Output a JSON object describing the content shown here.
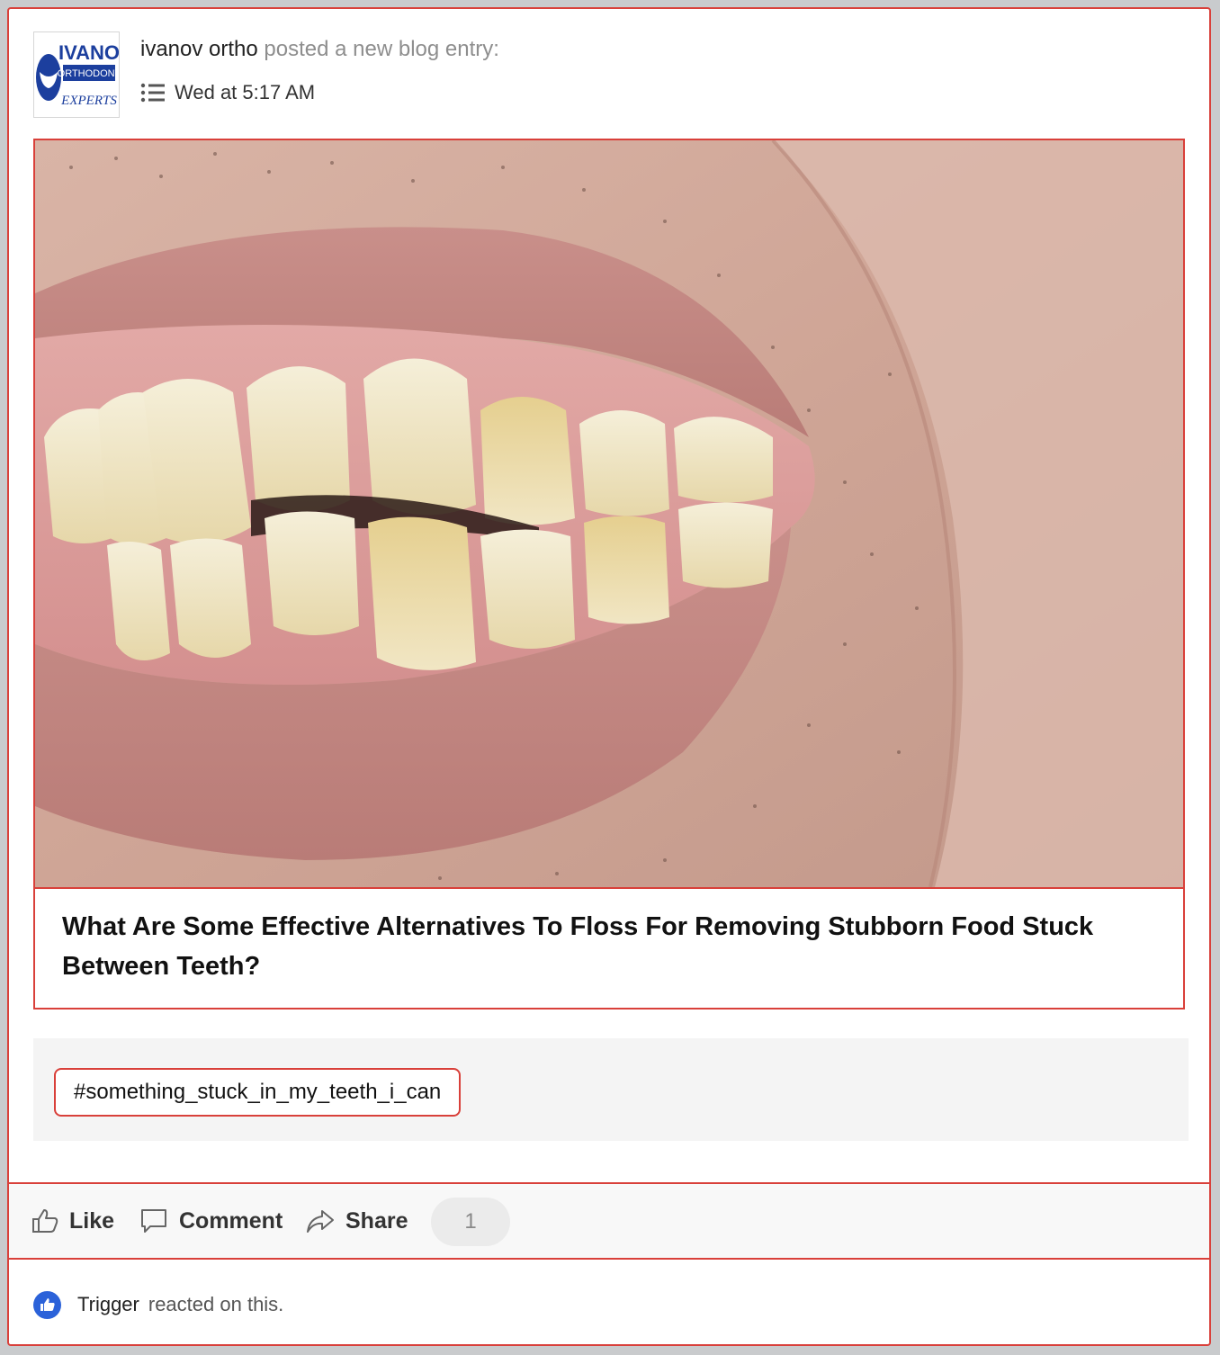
{
  "post": {
    "author": "ivanov ortho",
    "action_text": "posted a new blog entry:",
    "timestamp": "Wed at 5:17 AM",
    "avatar_logo_text": [
      "IVANO",
      "ORTHODONT",
      "EXPERTS"
    ]
  },
  "blog": {
    "title": "What Are Some Effective Alternatives To Floss For Removing Stubborn Food Stuck Between Teeth?"
  },
  "tags": [
    "#something_stuck_in_my_teeth_i_can"
  ],
  "actions": {
    "like_label": "Like",
    "comment_label": "Comment",
    "share_label": "Share",
    "reaction_count": "1"
  },
  "reaction": {
    "user": "Trigger",
    "text": "reacted on this."
  },
  "colors": {
    "highlight_border": "#d9403a",
    "like_badge": "#2b62d9",
    "logo_blue": "#1c3f9e"
  },
  "icons": [
    "list-icon",
    "thumbs-up-icon",
    "comment-icon",
    "share-icon",
    "like-badge-icon"
  ]
}
